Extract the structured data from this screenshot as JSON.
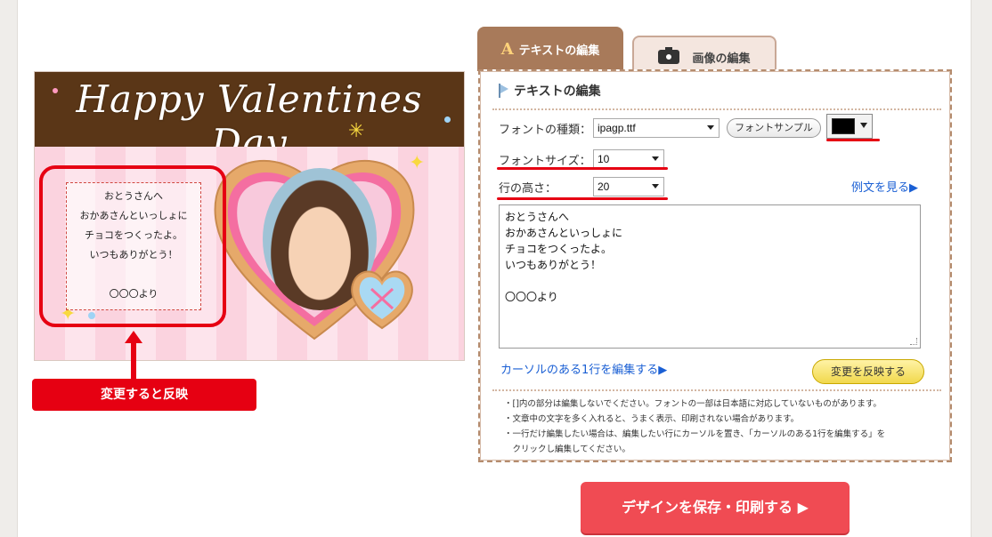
{
  "card": {
    "title": "Happy Valentines Day",
    "lines": [
      "おとうさんへ",
      "おかあさんといっしょに",
      "チョコをつくったよ。",
      "いつもありがとう！",
      "",
      "〇〇〇より"
    ]
  },
  "annotation": {
    "reflect_label": "変更すると反映"
  },
  "tabs": {
    "text_tab_icon": "A",
    "text_tab_label": "テキストの編集",
    "image_tab_label": "画像の編集"
  },
  "panel": {
    "title": "テキストの編集",
    "font_type_label": "フォントの種類：",
    "font_type_value": "ipagp.ttf",
    "font_sample_button": "フォントサンプル",
    "font_color": "#000000",
    "font_size_label": "フォントサイズ：",
    "font_size_value": "10",
    "line_height_label": "行の高さ：",
    "line_height_value": "20",
    "example_link": "例文を見る▶",
    "textarea_lines": [
      "おとうさんへ",
      "おかあさんといっしょに",
      "チョコをつくったよ。",
      "いつもありがとう！",
      "",
      "〇〇〇より"
    ],
    "edit_line_link": "カーソルのある1行を編集する▶",
    "apply_button": "変更を反映する",
    "notes": [
      "・[]内の部分は編集しないでください。フォントの一部は日本語に対応していないものがあります。",
      "・文章中の文字を多く入れると、うまく表示、印刷されない場合があります。",
      "・一行だけ編集したい場合は、編集したい行にカーソルを置き、「カーソルのある1行を編集する」を",
      "　クリックし編集してください。"
    ]
  },
  "save_button": "デザインを保存・印刷する ▶",
  "colors": {
    "accent_red": "#e60012",
    "tab_brown": "#a87a5a",
    "save_button": "#f04b53",
    "apply_button": "#f1d84c",
    "link_blue": "#1a5fd4"
  }
}
